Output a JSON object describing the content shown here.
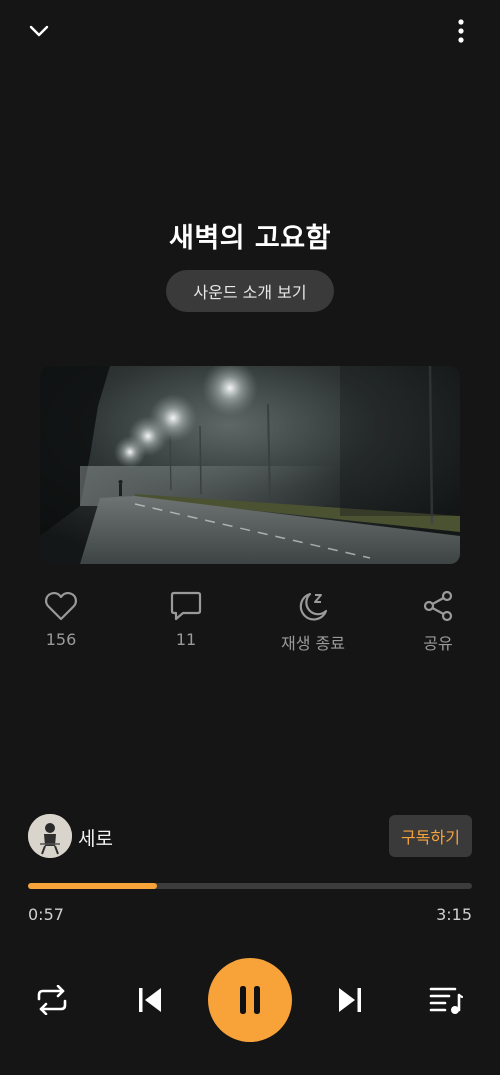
{
  "player": {
    "title": "새벽의 고요함",
    "intro_button": "사운드 소개 보기",
    "actions": {
      "like_count": "156",
      "comment_count": "11",
      "sleep_timer_label": "재생 종료",
      "share_label": "공유"
    },
    "artist": {
      "name": "세로",
      "subscribe_label": "구독하기"
    },
    "progress": {
      "current": "0:57",
      "total": "3:15",
      "fraction": 0.29
    },
    "icons": {
      "collapse": "chevron-down-icon",
      "more": "more-vertical-icon",
      "like": "heart-icon",
      "comment": "comment-icon",
      "sleep": "moon-zzz-icon",
      "share": "share-icon",
      "repeat": "repeat-icon",
      "previous": "skip-previous-icon",
      "play_pause": "pause-icon",
      "next": "skip-next-icon",
      "queue": "playlist-icon"
    },
    "colors": {
      "accent": "#f7a33a",
      "background": "#151515"
    }
  }
}
